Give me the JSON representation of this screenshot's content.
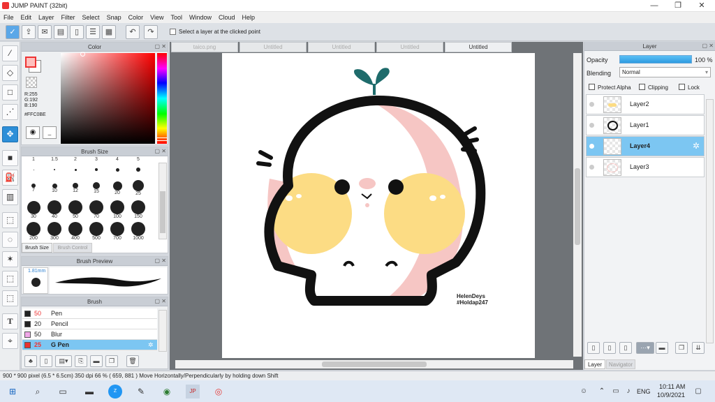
{
  "app": {
    "title": "JUMP PAINT (32bit)"
  },
  "menu": [
    "File",
    "Edit",
    "Layer",
    "Filter",
    "Select",
    "Snap",
    "Color",
    "View",
    "Tool",
    "Window",
    "Cloud",
    "Help"
  ],
  "toolbar": {
    "select_layer_label": "Select a layer at the clicked point"
  },
  "color_panel": {
    "title": "Color",
    "r": "R:255",
    "g": "G:192",
    "b": "B:190",
    "hex": "#FFC0BE",
    "accent": "#FFC0BE"
  },
  "brush_size": {
    "title": "Brush Size",
    "tab_active": "Brush Size",
    "tab_other": "Brush Control",
    "sizes": [
      "1",
      "1.5",
      "2",
      "3",
      "4",
      "5",
      "7",
      "10",
      "12",
      "15",
      "20",
      "25",
      "30",
      "40",
      "50",
      "70",
      "100",
      "150",
      "200",
      "300",
      "400",
      "500",
      "700",
      "1000"
    ]
  },
  "brush_preview": {
    "title": "Brush Preview",
    "size_label": "1.81mm"
  },
  "brush": {
    "title": "Brush",
    "items": [
      {
        "size": "50",
        "name": "Pen",
        "color": "#222222"
      },
      {
        "size": "20",
        "name": "Pencil",
        "color": "#222222"
      },
      {
        "size": "50",
        "name": "Blur",
        "color": "#f0a8e8"
      },
      {
        "size": "25",
        "name": "G Pen",
        "color": "#e83030"
      }
    ]
  },
  "tabs": [
    "taico.png",
    "Untitled",
    "Untitled",
    "Untitled",
    "Untitled"
  ],
  "canvas": {
    "signature_line1": "HelenDeys",
    "signature_line2": "#Holdap247"
  },
  "layer_panel": {
    "title": "Layer",
    "opacity_label": "Opacity",
    "opacity_value": "100 %",
    "blending_label": "Blending",
    "blending_value": "Normal",
    "protect_alpha": "Protect Alpha",
    "clipping": "Clipping",
    "lock": "Lock",
    "layers": [
      "Layer2",
      "Layer1",
      "Layer4",
      "Layer3"
    ],
    "tab_layer": "Layer",
    "tab_navigator": "Navigator"
  },
  "status": {
    "text": "900 * 900 pixel   (6.5 * 6.5cm)   350 dpi   66 %   ( 659, 881 )   Move Horizontally/Perpendicularly by holding down Shift"
  },
  "taskbar": {
    "lang": "ENG",
    "time": "10:11 AM",
    "date": "10/9/2021"
  }
}
